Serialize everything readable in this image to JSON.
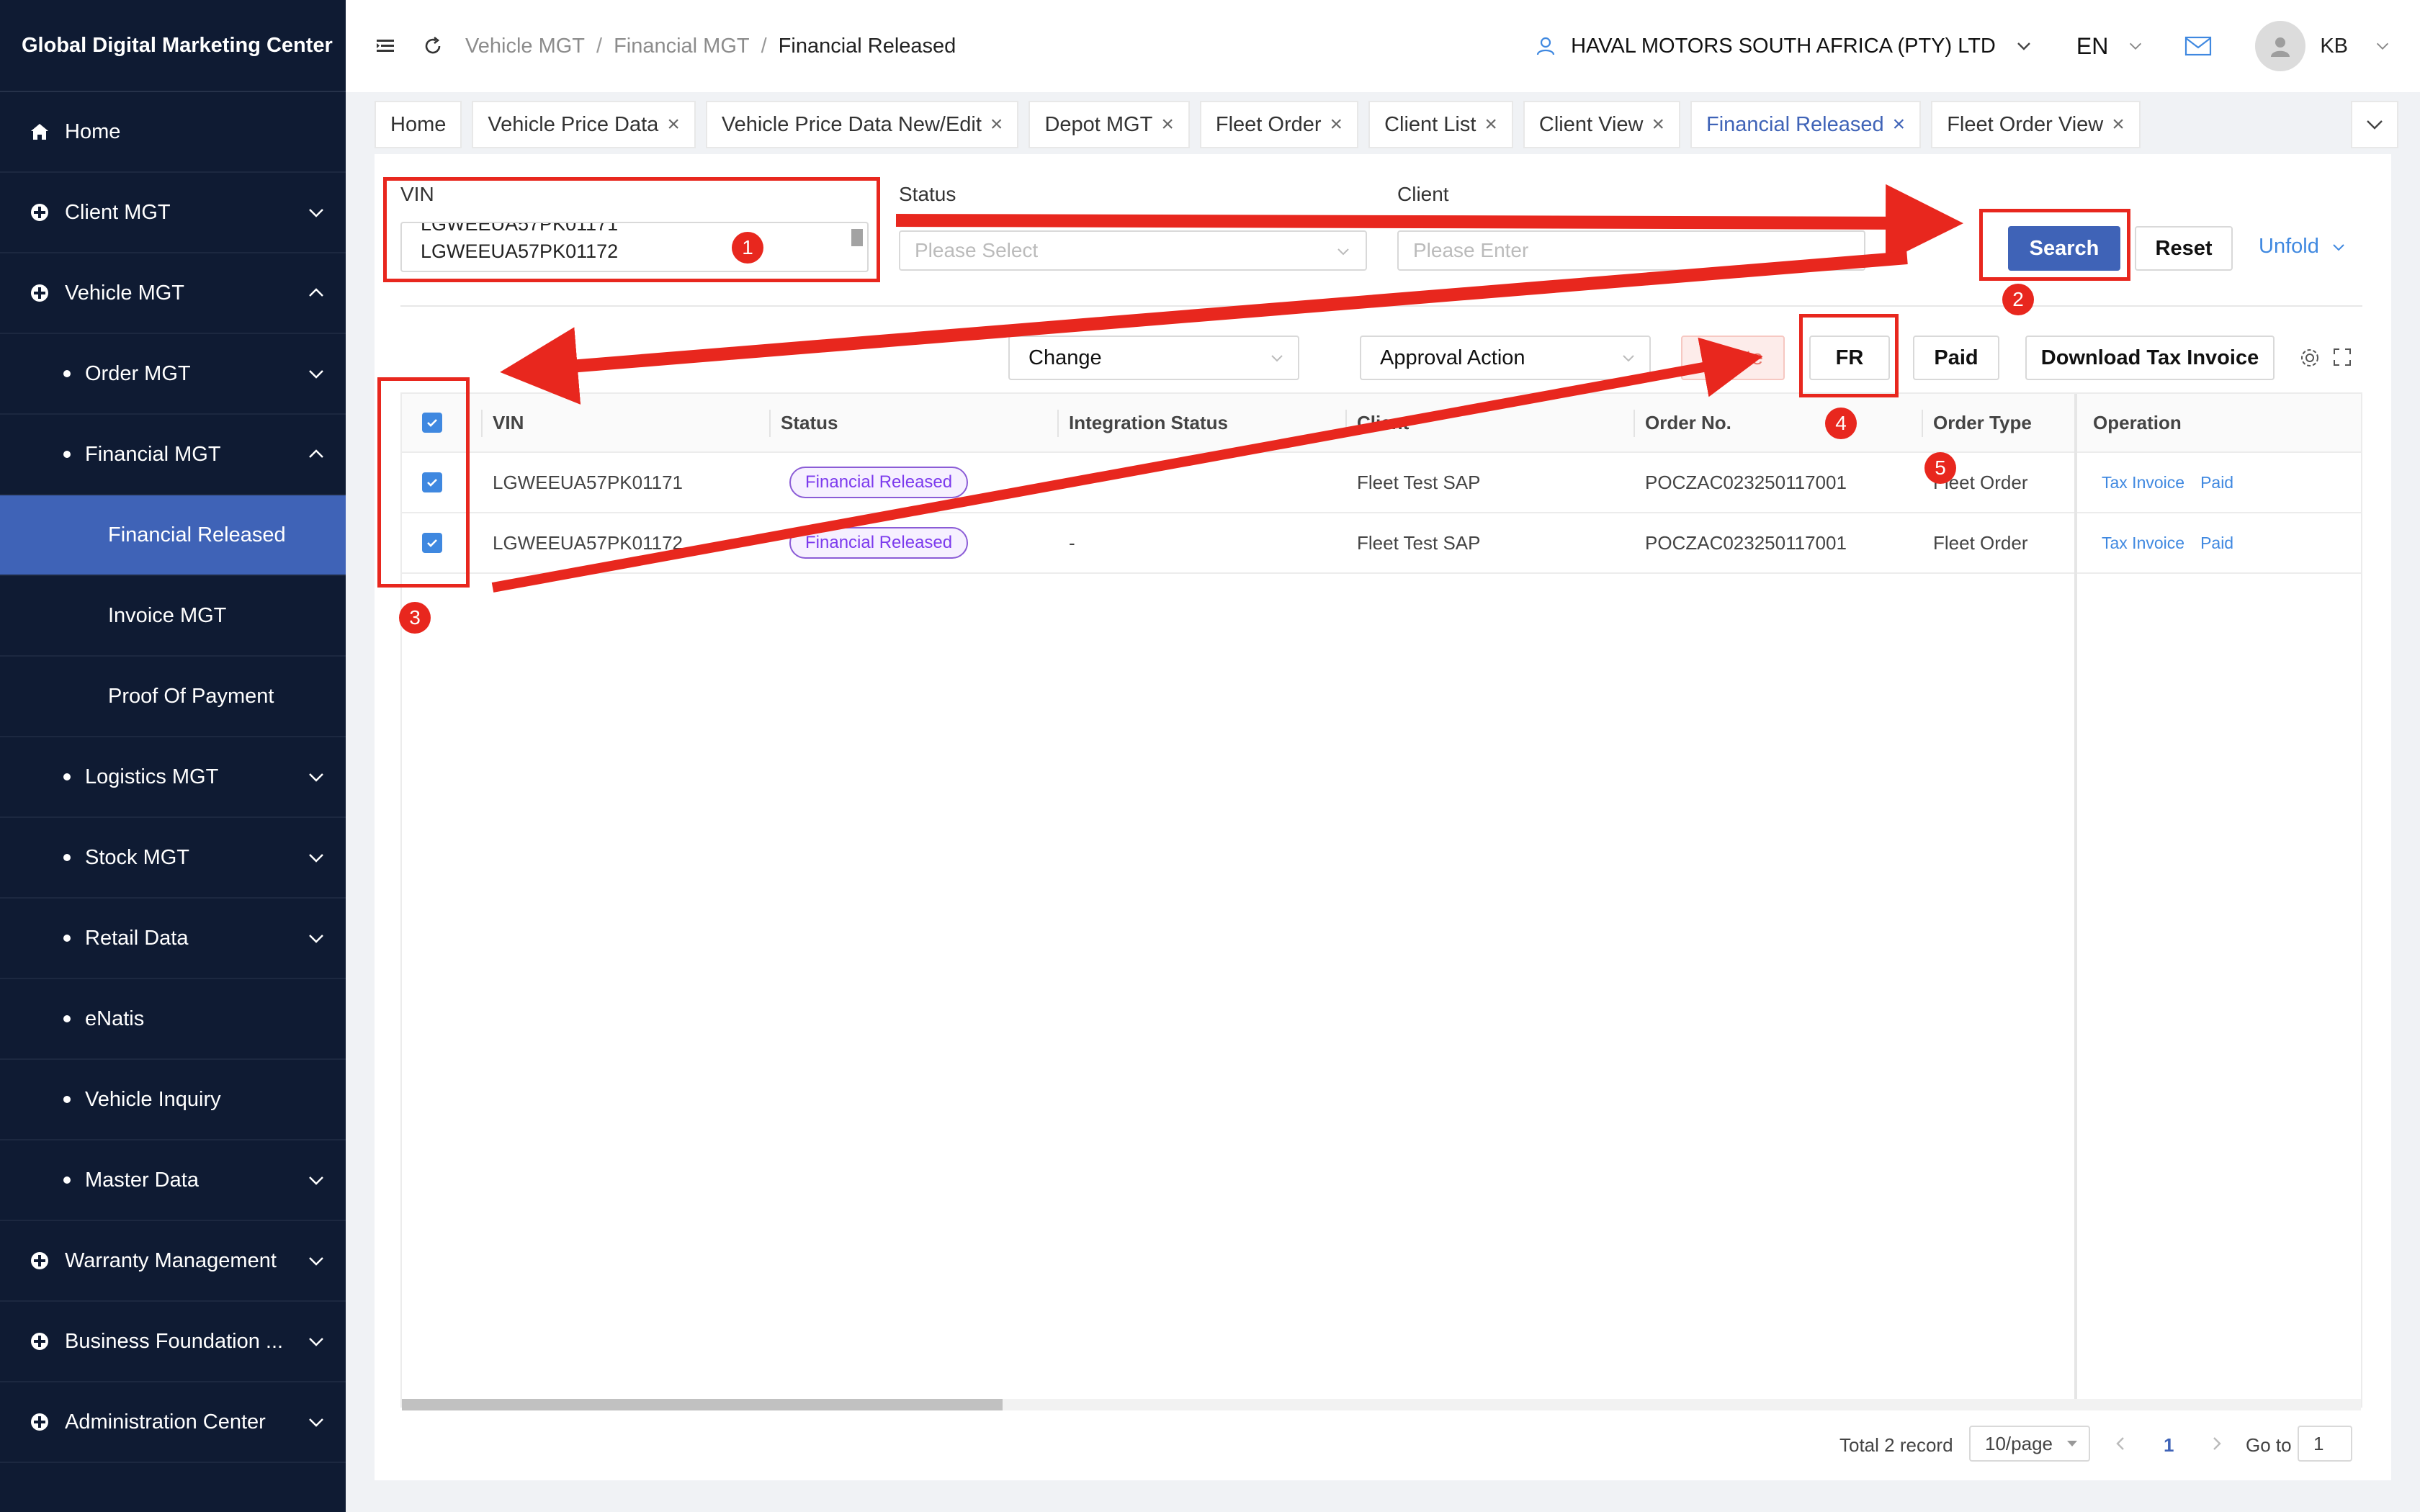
{
  "sidebar": {
    "title": "Global Digital Marketing Center",
    "items": [
      {
        "label": "Home"
      },
      {
        "label": "Client MGT"
      },
      {
        "label": "Vehicle MGT"
      },
      {
        "label": "Order MGT"
      },
      {
        "label": "Financial MGT"
      },
      {
        "label": "Financial Released"
      },
      {
        "label": "Invoice MGT"
      },
      {
        "label": "Proof Of Payment"
      },
      {
        "label": "Logistics MGT"
      },
      {
        "label": "Stock MGT"
      },
      {
        "label": "Retail Data"
      },
      {
        "label": "eNatis"
      },
      {
        "label": "Vehicle Inquiry"
      },
      {
        "label": "Master Data"
      },
      {
        "label": "Warranty Management"
      },
      {
        "label": "Business Foundation ..."
      },
      {
        "label": "Administration Center"
      }
    ]
  },
  "header": {
    "breadcrumb": [
      "Vehicle MGT",
      "Financial MGT",
      "Financial Released"
    ],
    "breadcrumb_sep": "/",
    "company": "HAVAL MOTORS SOUTH AFRICA (PTY) LTD",
    "language": "EN",
    "user_initials": "KB"
  },
  "tabs": [
    {
      "label": "Home"
    },
    {
      "label": "Vehicle Price Data"
    },
    {
      "label": "Vehicle Price Data New/Edit"
    },
    {
      "label": "Depot MGT"
    },
    {
      "label": "Fleet Order"
    },
    {
      "label": "Client List"
    },
    {
      "label": "Client View"
    },
    {
      "label": "Financial Released"
    },
    {
      "label": "Fleet Order View"
    }
  ],
  "tab_close": "×",
  "filters": {
    "vin_label": "VIN",
    "vin_lines": [
      "LGWEEUA57PK01171",
      "LGWEEUA57PK01172"
    ],
    "status_label": "Status",
    "status_placeholder": "Please Select",
    "client_label": "Client",
    "client_placeholder": "Please Enter",
    "search": "Search",
    "reset": "Reset",
    "unfold": "Unfold"
  },
  "toolbar": {
    "change": "Change",
    "approval": "Approval Action",
    "delete": "Delete",
    "fr": "FR",
    "paid": "Paid",
    "download": "Download Tax Invoice"
  },
  "table": {
    "columns": [
      "VIN",
      "Status",
      "Integration Status",
      "Client",
      "Order No.",
      "Order Type",
      "Operation"
    ],
    "rows": [
      {
        "vin": "LGWEEUA57PK01171",
        "status": "Financial Released",
        "integration": "-",
        "client": "Fleet Test SAP",
        "order_no": "POCZAC023250117001",
        "order_type": "Fleet Order",
        "op1": "Tax Invoice",
        "op2": "Paid"
      },
      {
        "vin": "LGWEEUA57PK01172",
        "status": "Financial Released",
        "integration": "-",
        "client": "Fleet Test SAP",
        "order_no": "POCZAC023250117001",
        "order_type": "Fleet Order",
        "op1": "Tax Invoice",
        "op2": "Paid"
      }
    ]
  },
  "pagination": {
    "total": "Total 2 record",
    "page_size": "10/page",
    "current": "1",
    "goto_label": "Go to",
    "goto_value": "1"
  },
  "annotations": [
    "1",
    "2",
    "3",
    "4",
    "5"
  ],
  "colors": {
    "accent": "#3f63b7",
    "annotation": "#e8271e",
    "sidebar": "#0f1b33",
    "badge": "#7c3aed"
  }
}
